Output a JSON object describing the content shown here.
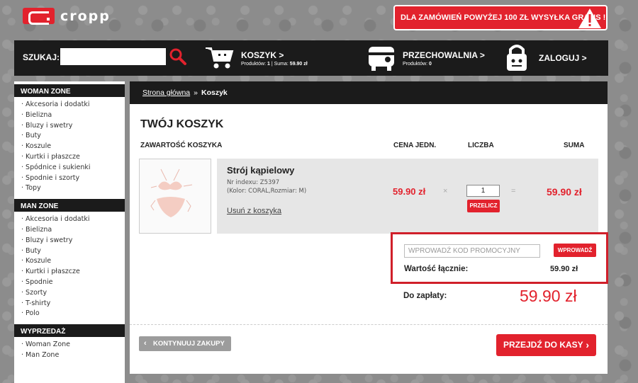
{
  "brand": {
    "name": "cropp"
  },
  "banner": {
    "text": "DLA ZAMÓWIEŃ POWYŻEJ 100 ZŁ WYSYŁKA GRATIS !",
    "icon": "warning-icon",
    "color": "#e2222d"
  },
  "header": {
    "search": {
      "label": "SZUKAJ:",
      "value": "",
      "placeholder": ""
    },
    "cart": {
      "title": "KOSZYK >",
      "products_label": "Produktów:",
      "products_count": "1",
      "sum_label": "Suma:",
      "sum_value": "59.90 zł"
    },
    "storage": {
      "title": "PRZECHOWALNIA >",
      "products_label": "Produktów:",
      "products_count": "0"
    },
    "login": {
      "title": "ZALOGUJ >"
    }
  },
  "sidebar": {
    "woman": {
      "title": "WOMAN ZONE",
      "items": [
        "Akcesoria i dodatki",
        "Bielizna",
        "Bluzy i swetry",
        "Buty",
        "Koszule",
        "Kurtki i płaszcze",
        "Spódnice i sukienki",
        "Spodnie i szorty",
        "Topy"
      ]
    },
    "man": {
      "title": "MAN ZONE",
      "items": [
        "Akcesoria i dodatki",
        "Bielizna",
        "Bluzy i swetry",
        "Buty",
        "Koszule",
        "Kurtki i płaszcze",
        "Spodnie",
        "Szorty",
        "T-shirty",
        "Polo"
      ]
    },
    "sale": {
      "title": "WYPRZEDAŻ",
      "items": [
        "Woman Zone",
        "Man Zone"
      ]
    }
  },
  "breadcrumb": {
    "home": "Strona główna",
    "sep": "»",
    "current": "Koszyk"
  },
  "cart": {
    "title": "TWÓJ KOSZYK",
    "columns": {
      "content": "ZAWARTOŚĆ KOSZYKA",
      "unit_price": "CENA JEDN.",
      "quantity": "LICZBA",
      "sum": "SUMA"
    },
    "item": {
      "name": "Strój kąpielowy",
      "index": "Nr indexu: Z5397",
      "variant": "(Kolor: CORAL,Rozmiar: M)",
      "remove": "Usuń z koszyka",
      "price": "59.90 zł",
      "times": "×",
      "qty": "1",
      "equals": "=",
      "total": "59.90 zł",
      "recalc": "PRZELICZ"
    },
    "promo": {
      "placeholder": "WPROWADŹ KOD PROMOCYJNY",
      "button": "WPROWADŹ"
    },
    "total": {
      "label": "Wartość łącznie:",
      "value": "59.90 zł"
    },
    "pay": {
      "label": "Do zapłaty:",
      "value": "59.90 zł"
    },
    "continue": "KONTYNUUJ ZAKUPY",
    "checkout": "PRZEJDŹ DO KASY"
  }
}
